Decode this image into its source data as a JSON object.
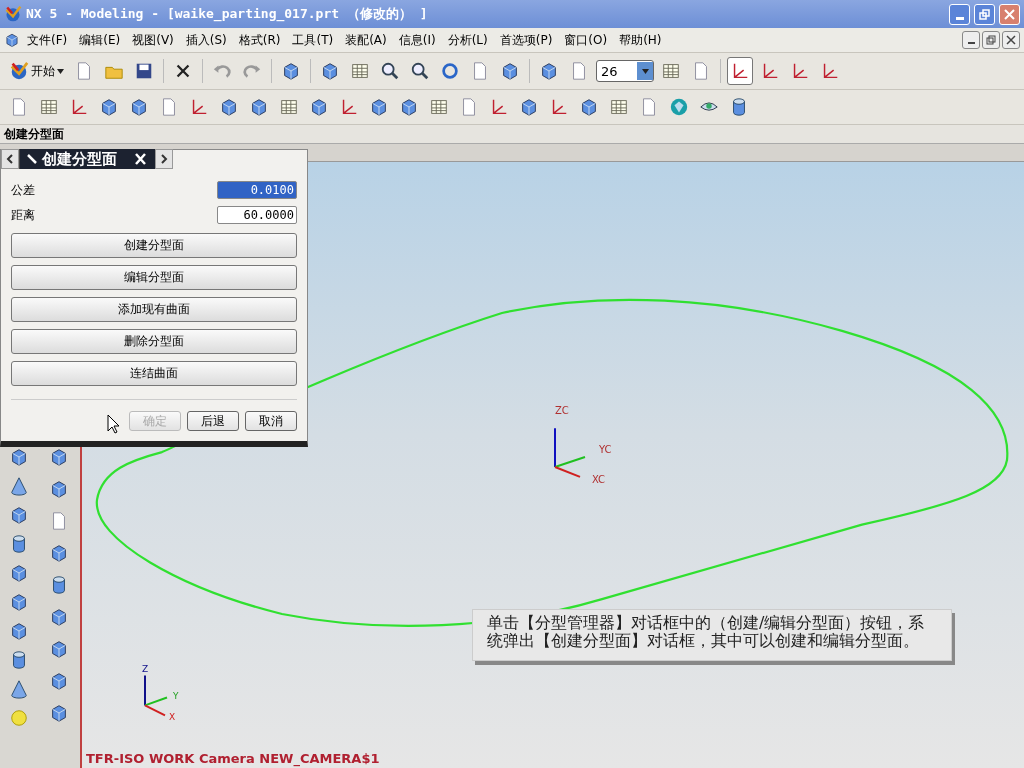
{
  "window": {
    "title": "NX 5 - Modeling - [waike_parting_017.prt （修改的） ]"
  },
  "menu": [
    "文件(F)",
    "编辑(E)",
    "视图(V)",
    "插入(S)",
    "格式(R)",
    "工具(T)",
    "装配(A)",
    "信息(I)",
    "分析(L)",
    "首选项(P)",
    "窗口(O)",
    "帮助(H)"
  ],
  "toolbar": {
    "start_label": "开始",
    "layer_value": "26"
  },
  "cue_line": "创建分型面",
  "dialog": {
    "title": "创建分型面",
    "fields": [
      {
        "label": "公差",
        "value": "0.0100",
        "selected": true
      },
      {
        "label": "距离",
        "value": "60.0000",
        "selected": false
      }
    ],
    "actions": [
      "创建分型面",
      "编辑分型面",
      "添加现有曲面",
      "删除分型面",
      "连结曲面"
    ],
    "footer_buttons": [
      {
        "label": "确定",
        "disabled": true
      },
      {
        "label": "后退",
        "disabled": false
      },
      {
        "label": "取消",
        "disabled": false
      }
    ]
  },
  "viewport": {
    "wcs_labels": [
      "ZC",
      "YC",
      "XC"
    ],
    "absolute_axes_labels": [
      "Z",
      "Y",
      "X"
    ],
    "status": "TFR-ISO WORK Camera NEW_CAMERA$1",
    "caption": "单击【分型管理器】对话框中的（创建/编辑分型面）按钮，系统弹出【创建分型面】对话框，其中可以创建和编辑分型面。"
  }
}
